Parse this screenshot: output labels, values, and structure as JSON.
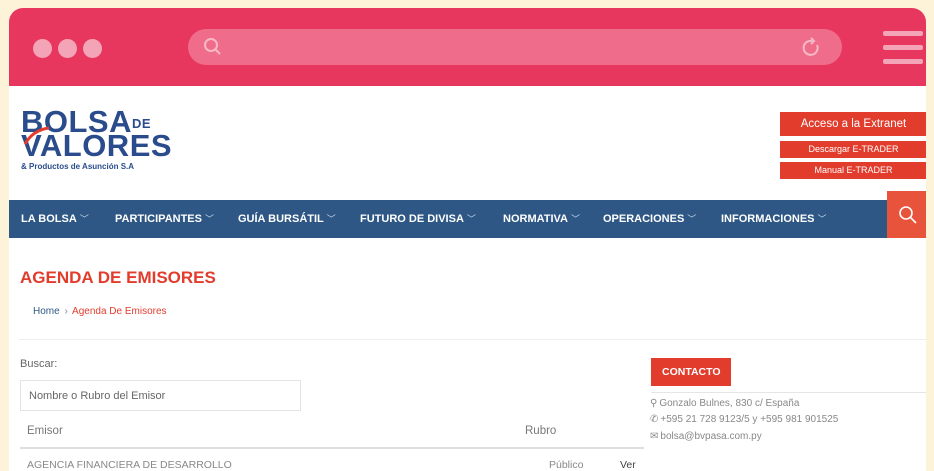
{
  "nav": {
    "items": [
      {
        "label": "LA BOLSA",
        "chevron": true
      },
      {
        "label": "PARTICIPANTES",
        "chevron": true
      },
      {
        "label": "GUÍA BURSÁTIL",
        "chevron": true
      },
      {
        "label": "FUTURO DE DIVISA",
        "chevron": true
      },
      {
        "label": "NORMATIVA",
        "chevron": true
      },
      {
        "label": "OPERACIONES",
        "chevron": true
      },
      {
        "label": "INFORMACIONES",
        "chevron": true
      }
    ],
    "search_icon": "search-icon"
  },
  "logo": {
    "line1": "BOLSA",
    "de": "DE",
    "line2": "VALORES",
    "subtitle": "& Productos de Asunción S.A"
  },
  "header_buttons": {
    "extranet": "Acceso a la Extranet",
    "etrader": "Descargar E-TRADER",
    "manual": "Manual E-TRADER"
  },
  "page": {
    "title": "AGENDA DE EMISORES",
    "breadcrumb": {
      "home": "Home",
      "separator": "›",
      "current": "Agenda De Emisores"
    }
  },
  "search": {
    "label": "Buscar:",
    "placeholder": "Nombre o Rubro del Emisor"
  },
  "table": {
    "columns": [
      "Emisor",
      "Rubro"
    ],
    "rows": [
      {
        "emisor": "AGENCIA FINANCIERA DE DESARROLLO",
        "rubro": "Público",
        "action": "Ver"
      }
    ]
  },
  "contact": {
    "heading": "CONTACTO",
    "address": "Gonzalo Bulnes, 830 c/ España",
    "phones": "+595 21 728 9123/5 y +595 981 901525",
    "email": "bolsa@bvpasa.com.py"
  },
  "colors": {
    "browser_bar": "#e8375f",
    "brand_red": "#e23c2d",
    "nav_blue": "#2e5785",
    "logo_blue": "#2a4c8c"
  }
}
